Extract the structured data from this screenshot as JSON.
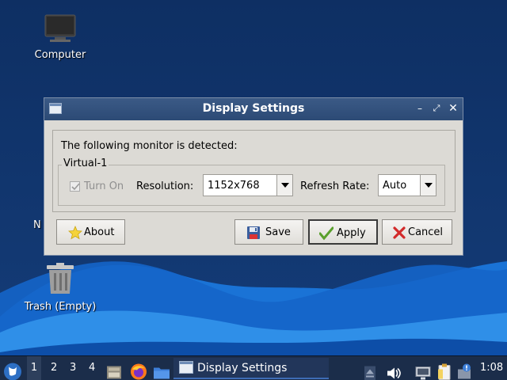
{
  "desktop": {
    "icons": [
      {
        "label": "Computer"
      },
      {
        "label": "Trash (Empty)"
      },
      {
        "label": "N"
      }
    ]
  },
  "window": {
    "title": "Display Settings",
    "detected_text": "The following monitor is detected:",
    "monitor_name": "Virtual-1",
    "turn_on_label": "Turn On",
    "turn_on_checked": true,
    "resolution_label": "Resolution:",
    "resolution_value": "1152x768",
    "refresh_label": "Refresh Rate:",
    "refresh_value": "Auto",
    "buttons": {
      "about": "About",
      "save": "Save",
      "apply": "Apply",
      "cancel": "Cancel"
    }
  },
  "taskbar": {
    "workspaces": [
      "1",
      "2",
      "3",
      "4"
    ],
    "active_workspace": "1",
    "task_label": "Display Settings",
    "clock": "1:08"
  },
  "colors": {
    "desktop_bg": "#0f3369",
    "wave_light": "#2f8fe8",
    "wave_dark": "#1565c9",
    "titlebar": "#2c4a75",
    "dialog_bg": "#dcdad5",
    "taskbar_bg": "#1b2d4a"
  }
}
